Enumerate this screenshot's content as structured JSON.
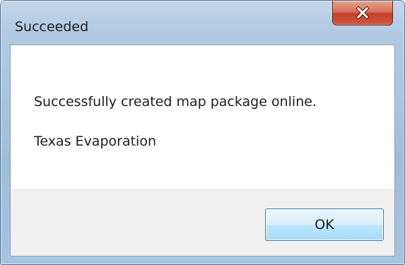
{
  "dialog": {
    "title": "Succeeded",
    "close_icon": "close-icon"
  },
  "message": {
    "line1": "Successfully created map package online.",
    "line2": "Texas Evaporation"
  },
  "buttons": {
    "ok_label": "OK"
  },
  "colors": {
    "close_button": "#c8452d",
    "frame": "#a9c4df",
    "footer": "#f0f0f0",
    "ok_button_border": "#3c7fb1"
  }
}
